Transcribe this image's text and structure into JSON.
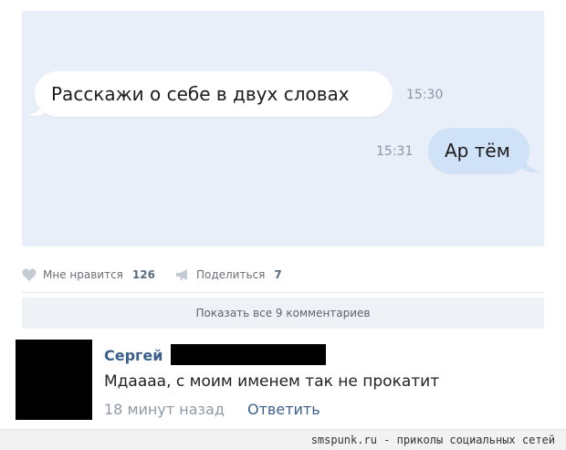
{
  "post": {
    "messages": [
      {
        "text": "Расскажи о себе в двух словах",
        "time": "15:30",
        "direction": "incoming"
      },
      {
        "text": "Ар тём",
        "time": "15:31",
        "direction": "outgoing"
      }
    ]
  },
  "actions": {
    "like_label": "Мне нравится",
    "like_count": "126",
    "share_label": "Поделиться",
    "share_count": "7"
  },
  "comments": {
    "show_all_label": "Показать все 9 комментариев",
    "items": [
      {
        "author": "Сергей",
        "text": "Мдаааа, с моим именем так не прокатит",
        "time": "18 минут назад",
        "reply_label": "Ответить"
      }
    ]
  },
  "footer": {
    "text": "smspunk.ru - приколы социальных сетей"
  },
  "colors": {
    "chat_background": "#e9eff9",
    "incoming_bubble": "#ffffff",
    "outgoing_bubble": "#d0e2f8",
    "link": "#3a5f8a",
    "muted": "#8f9aa6"
  },
  "icons": {
    "like": "heart-icon",
    "share": "megaphone-icon"
  }
}
